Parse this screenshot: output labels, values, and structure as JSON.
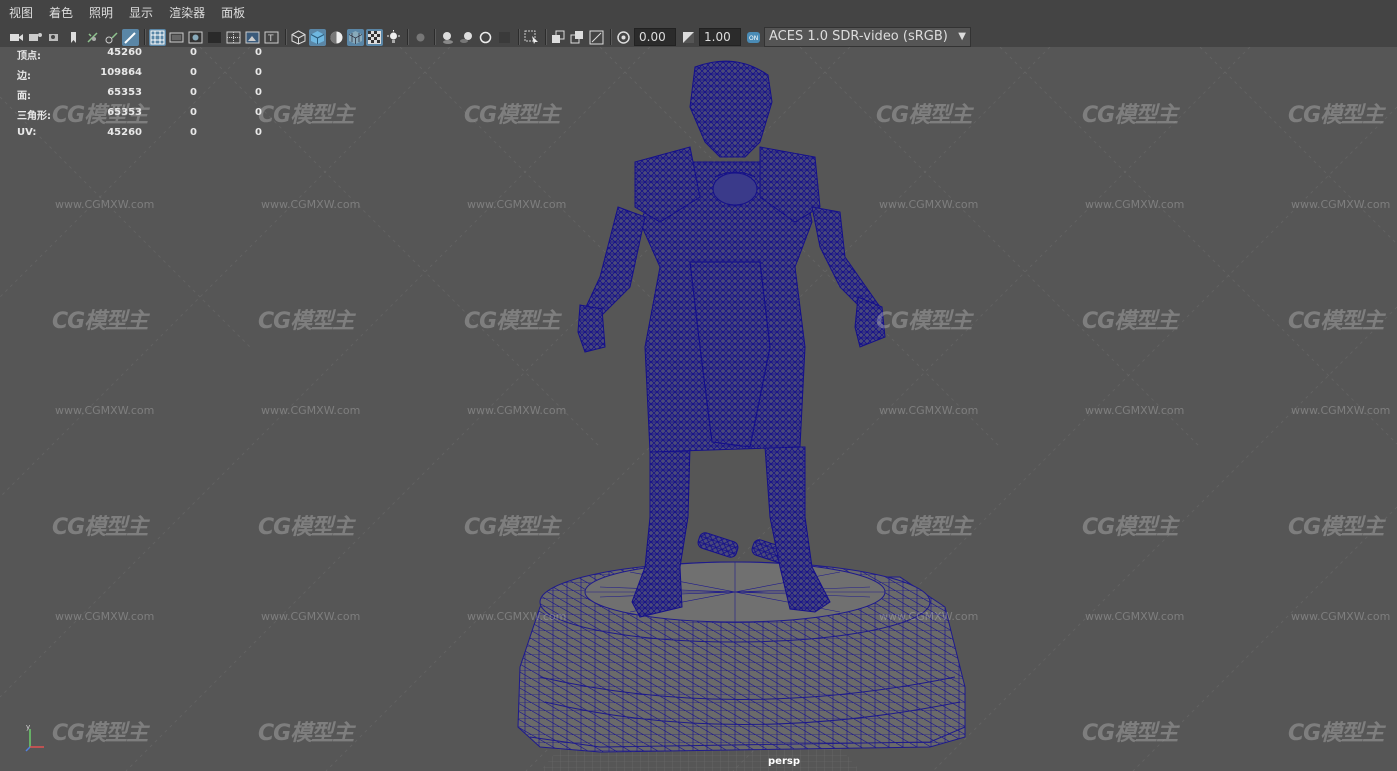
{
  "menubar": {
    "items": [
      "视图",
      "着色",
      "照明",
      "显示",
      "渲染器",
      "面板"
    ]
  },
  "toolbar": {
    "field_a": "0.00",
    "field_b": "1.00",
    "color_management": "ACES 1.0 SDR-video (sRGB)",
    "icons": [
      "camera-icon",
      "camera-attributes-icon",
      "bookmark-icon",
      "image-plane-icon",
      "grid-icon",
      "film-gate-icon",
      "resolution-gate-icon",
      "gate-mask-icon",
      "field-chart-icon",
      "safe-action-icon",
      "safe-title-icon",
      "wireframe-icon",
      "smooth-shade-icon",
      "default-material-icon",
      "wireframe-on-shaded-icon",
      "textured-icon",
      "use-all-lights-icon",
      "shadows-icon",
      "ambient-occlusion-icon",
      "motion-blur-icon",
      "anti-aliasing-icon",
      "depth-of-field-icon",
      "isolate-select-icon",
      "xray-icon",
      "xray-joints-icon",
      "xray-active-icon",
      "exposure-icon",
      "gamma-icon",
      "color-management-icon"
    ]
  },
  "hud": {
    "rows": [
      {
        "label": "顶点:",
        "value": "45260",
        "c1": "0",
        "c2": "0"
      },
      {
        "label": "边:",
        "value": "109864",
        "c1": "0",
        "c2": "0"
      },
      {
        "label": "面:",
        "value": "65353",
        "c1": "0",
        "c2": "0"
      },
      {
        "label": "三角形:",
        "value": "65353",
        "c1": "0",
        "c2": "0"
      },
      {
        "label": "UV:",
        "value": "45260",
        "c1": "0",
        "c2": "0"
      }
    ]
  },
  "viewport": {
    "camera": "persp",
    "watermark_logo": "CG模型主",
    "watermark_url": "www.CGMXW.com",
    "axis_label": "y"
  },
  "colors": {
    "wire": "#1e1a8c",
    "viewport_bg": "#565656",
    "ui_bg": "#444444",
    "active_icon": "#5a86a6"
  }
}
